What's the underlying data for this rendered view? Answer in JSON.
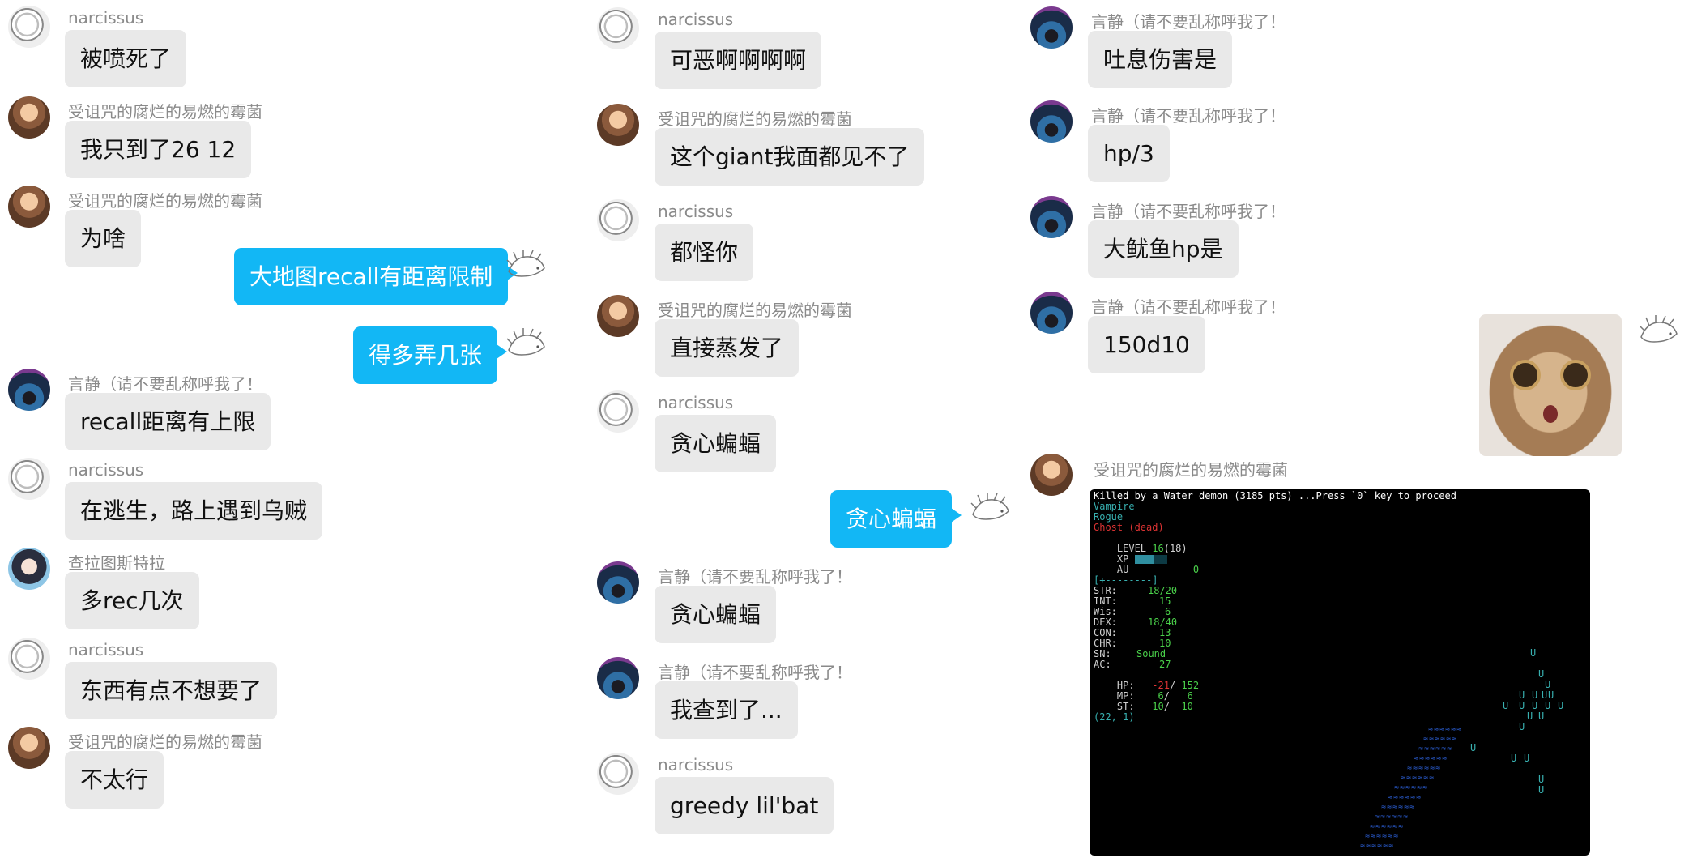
{
  "users": {
    "narcissus": "narcissus",
    "mold": "受诅咒的腐烂的易燃的霉菌",
    "yanjing": "言静（请不要乱称呼我了！",
    "chara": "查拉图斯特拉"
  },
  "colors": {
    "self_bubble": "#12b7f5",
    "other_bubble": "#e9e9e9",
    "name_text": "#8a8a8a"
  },
  "col1": {
    "m1": "被喷死了",
    "m2": "我只到了26 12",
    "m3": "为啥",
    "self1": "大地图recall有距离限制",
    "self2": "得多弄几张",
    "m4": "recall距离有上限",
    "m5": "在逃生，路上遇到乌贼",
    "m6": "多rec几次",
    "m7": "东西有点不想要了",
    "m8": "不太行"
  },
  "col2": {
    "m1": "可恶啊啊啊啊",
    "m2": "这个giant我面都见不了",
    "m3": "都怪你",
    "m4": "直接蒸发了",
    "m5": "贪心蝙蝠",
    "self1": "贪心蝙蝠",
    "m6": "贪心蝙蝠",
    "m7": "我查到了...",
    "m8": "greedy lil'bat"
  },
  "col3": {
    "m1": "吐息伤害是",
    "m2": "hp/3",
    "m3": "大鱿鱼hp是",
    "m4": "150d10"
  },
  "icons": {
    "self_avatar": "hedgehog-sketch-icon",
    "cat_sticker": "surprised-cat-sticker"
  },
  "game": {
    "header": "Killed by a Water demon (3185 pts) ...Press `0` key to proceed",
    "race": "Vampire",
    "class": "Rogue",
    "status": "Ghost (dead)",
    "level_label": "LEVEL",
    "level_value": "16",
    "level_max": "(18)",
    "xp_label": "XP",
    "xp_progress": 0.6,
    "au_label": "AU",
    "au_value": "0",
    "bar": "[+--------]",
    "stats": [
      {
        "label": "STR:",
        "value": "18/20"
      },
      {
        "label": "INT:",
        "value": "15"
      },
      {
        "label": "Wis:",
        "value": "6"
      },
      {
        "label": "DEX:",
        "value": "18/40"
      },
      {
        "label": "CON:",
        "value": "13"
      },
      {
        "label": "CHR:",
        "value": "10"
      },
      {
        "label": "SN:",
        "value": "Sound"
      },
      {
        "label": "AC:",
        "value": "27"
      }
    ],
    "hp_label": "HP:",
    "hp_cur": "-21",
    "hp_max": "152",
    "mp_label": "MP:",
    "mp_cur": "6",
    "mp_max": "6",
    "st_label": "ST:",
    "st_cur": "10",
    "st_max": "10",
    "coords": "(22, 1)",
    "monster_glyph": "U",
    "water_glyph": "≈≈≈≈≈≈"
  }
}
